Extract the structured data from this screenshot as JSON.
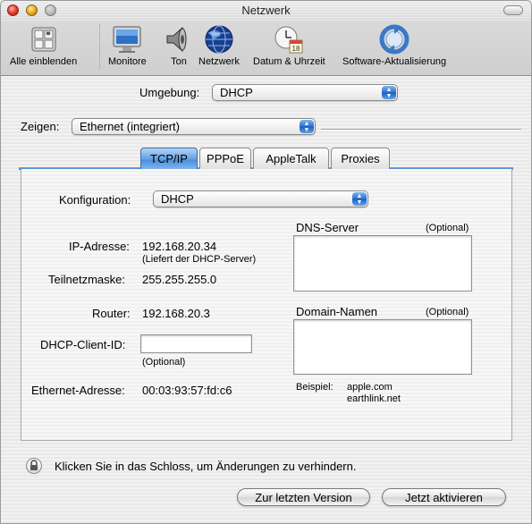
{
  "window": {
    "title": "Netzwerk"
  },
  "toolbar": {
    "items": [
      {
        "label": "Alle einblenden",
        "icon": "show-all-icon"
      },
      {
        "label": "Monitore",
        "icon": "monitor-icon"
      },
      {
        "label": "Ton",
        "icon": "speaker-icon"
      },
      {
        "label": "Netzwerk",
        "icon": "globe-icon"
      },
      {
        "label": "Datum & Uhrzeit",
        "icon": "clock-calendar-icon"
      },
      {
        "label": "Software-Aktualisierung",
        "icon": "software-update-icon"
      }
    ],
    "calendar_day": "18"
  },
  "location": {
    "label": "Umgebung:",
    "value": "DHCP"
  },
  "show": {
    "label": "Zeigen:",
    "value": "Ethernet (integriert)"
  },
  "tabs": [
    {
      "label": "TCP/IP",
      "active": true
    },
    {
      "label": "PPPoE",
      "active": false
    },
    {
      "label": "AppleTalk",
      "active": false
    },
    {
      "label": "Proxies",
      "active": false
    }
  ],
  "tcpip": {
    "config_label": "Konfiguration:",
    "config_value": "DHCP",
    "ip_label": "IP-Adresse:",
    "ip_value": "192.168.20.34",
    "ip_note": "(Liefert der DHCP-Server)",
    "subnet_label": "Teilnetzmaske:",
    "subnet_value": "255.255.255.0",
    "router_label": "Router:",
    "router_value": "192.168.20.3",
    "client_id_label": "DHCP-Client-ID:",
    "client_id_value": "",
    "client_id_note": "(Optional)",
    "ethernet_label": "Ethernet-Adresse:",
    "ethernet_value": "00:03:93:57:fd:c6",
    "dns_label": "DNS-Server",
    "dns_optional": "(Optional)",
    "domain_label": "Domain-Namen",
    "domain_optional": "(Optional)",
    "example_label": "Beispiel:",
    "example_line1": "apple.com",
    "example_line2": "earthlink.net"
  },
  "lock": {
    "text": "Klicken Sie in das Schloss, um Änderungen zu verhindern."
  },
  "buttons": {
    "revert": "Zur letzten Version",
    "apply": "Jetzt aktivieren"
  },
  "colors": {
    "accent": "#3c7fcf",
    "close": "#e33c2c",
    "minimize": "#e9a920"
  }
}
